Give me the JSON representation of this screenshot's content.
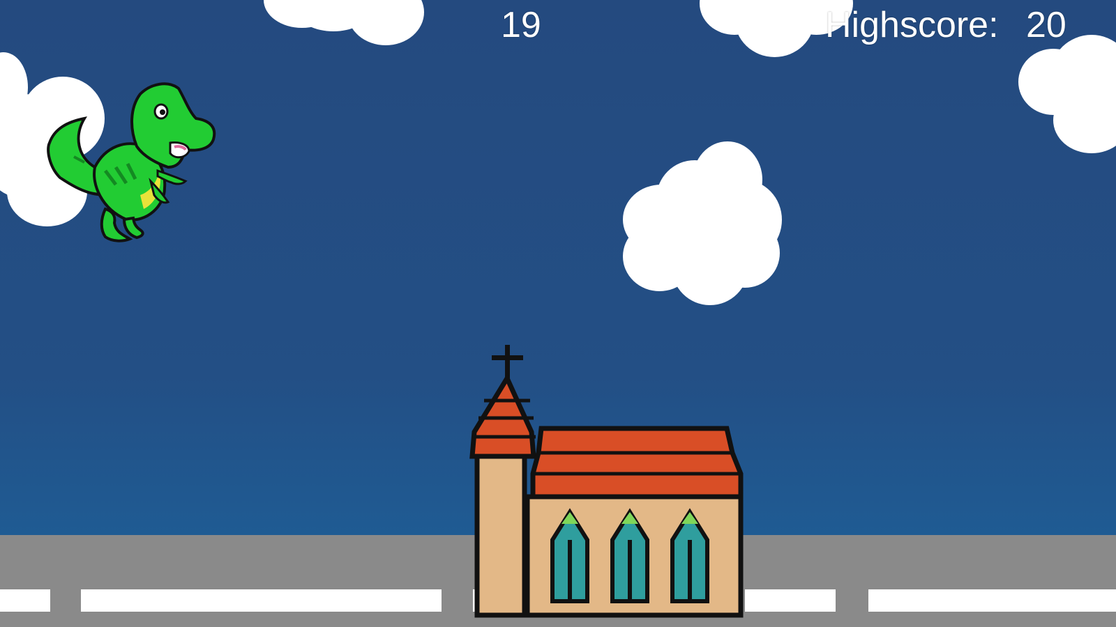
{
  "hud": {
    "score": "19",
    "highscore_label": "Highscore:",
    "highscore_value": "20"
  },
  "sprites": {
    "player": "green-dinosaur",
    "obstacle": "church-with-steeple",
    "background_objects": [
      "cloud",
      "road-lane-marking"
    ]
  },
  "colors": {
    "sky": "#244a7f",
    "road": "#8a8a8a",
    "lane_marking": "#ffffff",
    "dino_green": "#22cc33",
    "roof_orange": "#d94e26",
    "wall_tan": "#e3b887",
    "window_teal": "#2f9e9e"
  }
}
